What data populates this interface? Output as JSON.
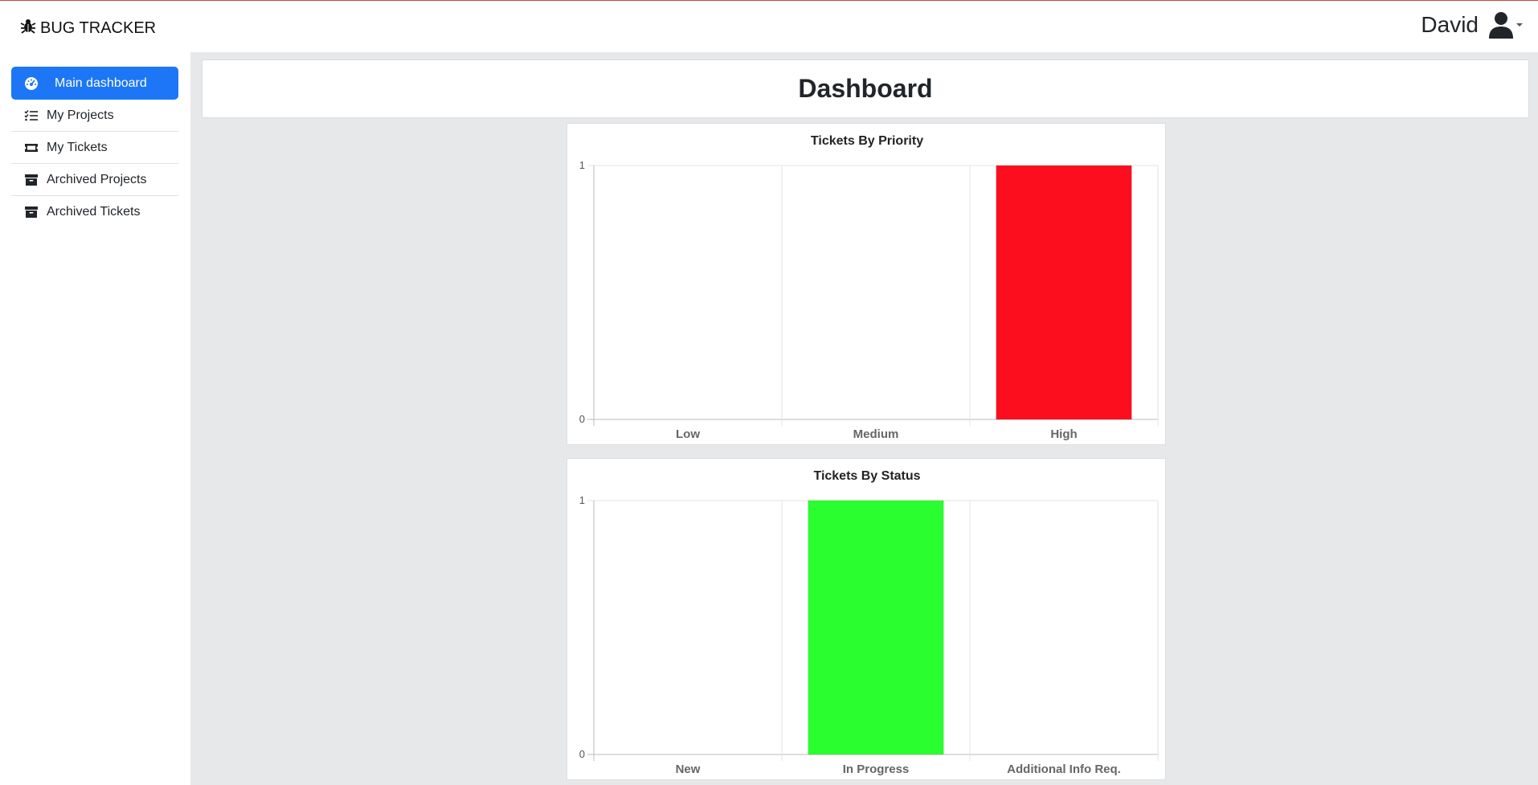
{
  "app": {
    "title": "BUG TRACKER"
  },
  "user": {
    "name": "David"
  },
  "sidebar": {
    "items": [
      {
        "label": "Main dashboard",
        "icon": "gauge-icon",
        "active": true
      },
      {
        "label": "My Projects",
        "icon": "list-check-icon",
        "active": false
      },
      {
        "label": "My Tickets",
        "icon": "ticket-icon",
        "active": false
      },
      {
        "label": "Archived Projects",
        "icon": "archive-icon",
        "active": false
      },
      {
        "label": "Archived Tickets",
        "icon": "archive-icon",
        "active": false
      }
    ]
  },
  "page": {
    "title": "Dashboard"
  },
  "colors": {
    "accent": "#1c76f5",
    "priority_bar": "#fd0e1f",
    "status_bar": "#2afe2f"
  },
  "chart_data": [
    {
      "type": "bar",
      "title": "Tickets By Priority",
      "categories": [
        "Low",
        "Medium",
        "High"
      ],
      "values": [
        0,
        0,
        1
      ],
      "ylim": [
        0,
        1
      ],
      "yticks": [
        "0",
        "1"
      ],
      "grid": true,
      "bar_color": "#fd0e1f"
    },
    {
      "type": "bar",
      "title": "Tickets By Status",
      "categories": [
        "New",
        "In Progress",
        "Additional Info Req."
      ],
      "values": [
        0,
        1,
        0
      ],
      "ylim": [
        0,
        1
      ],
      "yticks": [
        "0",
        "1"
      ],
      "grid": true,
      "bar_color": "#2afe2f"
    }
  ]
}
